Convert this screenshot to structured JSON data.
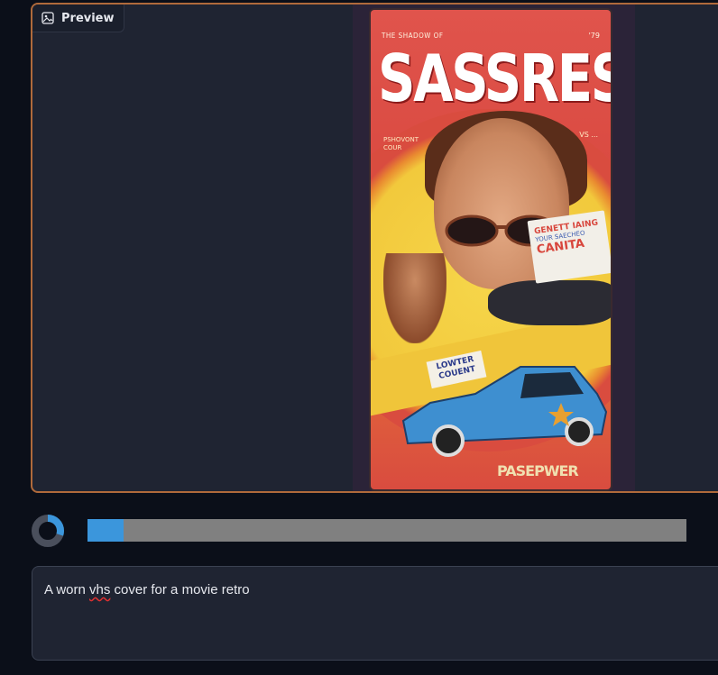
{
  "preview": {
    "label": "Preview",
    "icon": "image-icon",
    "image": {
      "description_alt": "Worn VHS cover",
      "cover": {
        "top_left_text": "THE SHADOW OF",
        "top_right_text": "'79",
        "title": "SASSRES",
        "sub_left": "PSHOVONT\nCOUR",
        "sub_right": "VS ...",
        "sticker": [
          "GENETT IAING",
          "YOUR SAECHEO",
          "CANITA"
        ],
        "badge": "LOWTER COUENT",
        "footer": "PASEPWER"
      }
    }
  },
  "progress": {
    "value_fraction": 0.06,
    "spinner_fraction": 0.3,
    "accent": "#3b96dc",
    "track": "#808080"
  },
  "prompt": {
    "text_before": "A worn ",
    "misspelled": "vhs",
    "text_after": " cover for a movie retro"
  },
  "colors": {
    "background": "#0b0f19",
    "panel": "#1f2432",
    "panel_border_active": "#b06a3b"
  }
}
